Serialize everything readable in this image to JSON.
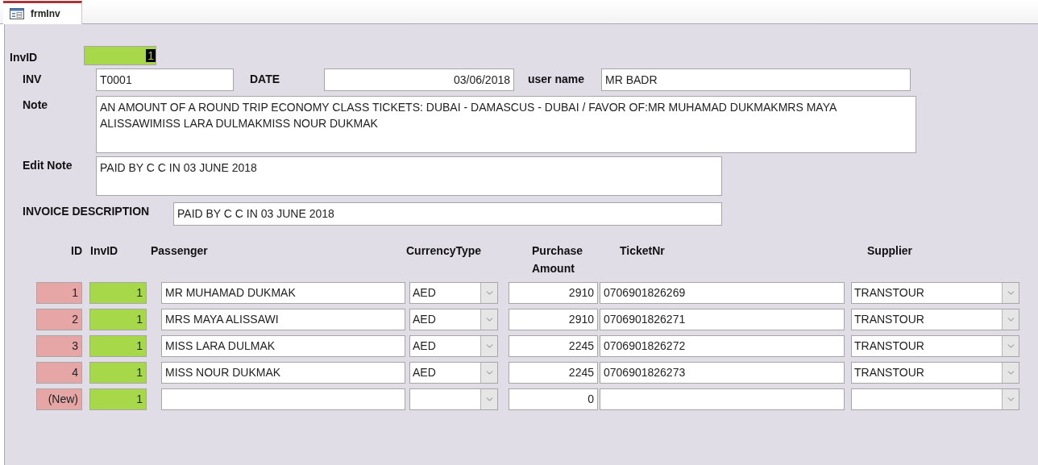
{
  "tab": {
    "title": "frmInv",
    "selected": true
  },
  "header": {
    "invid": {
      "label": "InvID",
      "value": "1",
      "text_selected": true
    },
    "inv": {
      "label": "INV",
      "value": "T0001"
    },
    "date": {
      "label": "DATE",
      "value": "03/06/2018"
    },
    "user_name": {
      "label": "user name",
      "value": "MR BADR"
    },
    "note": {
      "label": "Note",
      "value": "AN AMOUNT OF A ROUND TRIP ECONOMY CLASS TICKETS: DUBAI - DAMASCUS - DUBAI / FAVOR OF:MR MUHAMAD DUKMAKMRS MAYA ALISSAWIMISS LARA DULMAKMISS NOUR DUKMAK"
    },
    "edit_note": {
      "label": "Edit Note",
      "value": "PAID BY C C IN 03 JUNE 2018"
    },
    "invoice_description": {
      "label": "INVOICE DESCRIPTION",
      "value": "PAID BY C C IN 03 JUNE 2018"
    }
  },
  "subform": {
    "columns": [
      "ID",
      "InvID",
      "Passenger",
      "CurrencyType",
      "Purchase Amount",
      "TicketNr",
      "Supplier"
    ],
    "rows": [
      {
        "id": "1",
        "inv_id": "1",
        "passenger": "MR MUHAMAD DUKMAK",
        "currency": "AED",
        "purchase_amount": "2910",
        "ticket_nr": "0706901826269",
        "supplier": "TRANSTOUR"
      },
      {
        "id": "2",
        "inv_id": "1",
        "passenger": "MRS MAYA ALISSAWI",
        "currency": "AED",
        "purchase_amount": "2910",
        "ticket_nr": "0706901826271",
        "supplier": "TRANSTOUR"
      },
      {
        "id": "3",
        "inv_id": "1",
        "passenger": "MISS LARA DULMAK",
        "currency": "AED",
        "purchase_amount": "2245",
        "ticket_nr": "0706901826272",
        "supplier": "TRANSTOUR"
      },
      {
        "id": "4",
        "inv_id": "1",
        "passenger": "MISS NOUR DUKMAK",
        "currency": "AED",
        "purchase_amount": "2245",
        "ticket_nr": "0706901826273",
        "supplier": "TRANSTOUR"
      },
      {
        "id": "(New)",
        "inv_id": "1",
        "purchase_amount": "0"
      }
    ]
  }
}
